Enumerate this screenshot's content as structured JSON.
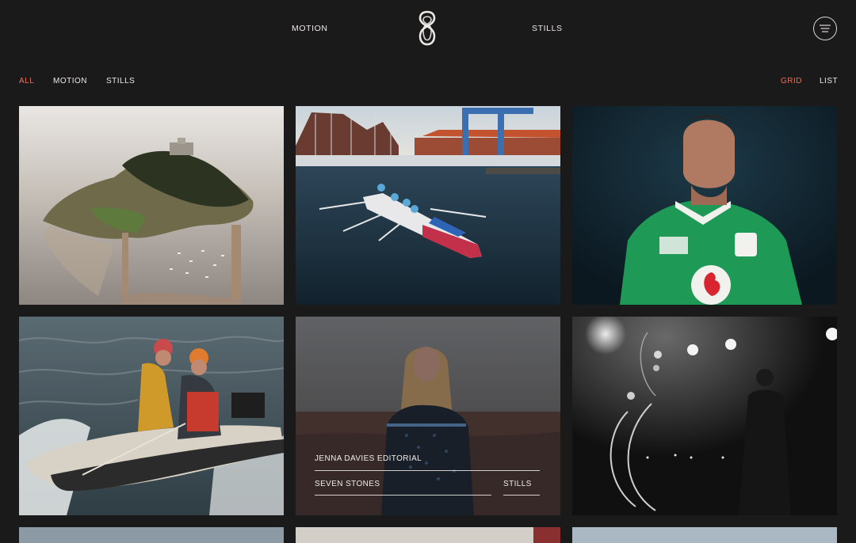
{
  "nav": {
    "motion_label": "MOTION",
    "stills_label": "STILLS"
  },
  "filters": {
    "all": "ALL",
    "motion": "MOTION",
    "stills": "STILLS",
    "active": "ALL"
  },
  "view": {
    "grid": "GRID",
    "list": "LIST",
    "active": "GRID"
  },
  "colors": {
    "accent": "#e5725c",
    "background": "#1b1a1a",
    "text": "#ece9e6"
  },
  "icons": {
    "logo": "figure-eight-logo-icon",
    "menu": "hamburger-menu-icon"
  },
  "projects": [
    {
      "subject": "island-aerial"
    },
    {
      "subject": "rowing-boat-harbour"
    },
    {
      "subject": "rugby-player-portrait"
    },
    {
      "subject": "inflatable-boat-crew"
    },
    {
      "subject": "woman-moorland",
      "title": "JENNA DAVIES EDITORIAL",
      "client": "SEVEN STONES",
      "category": "STILLS"
    },
    {
      "subject": "stage-performer-silhouette"
    }
  ]
}
